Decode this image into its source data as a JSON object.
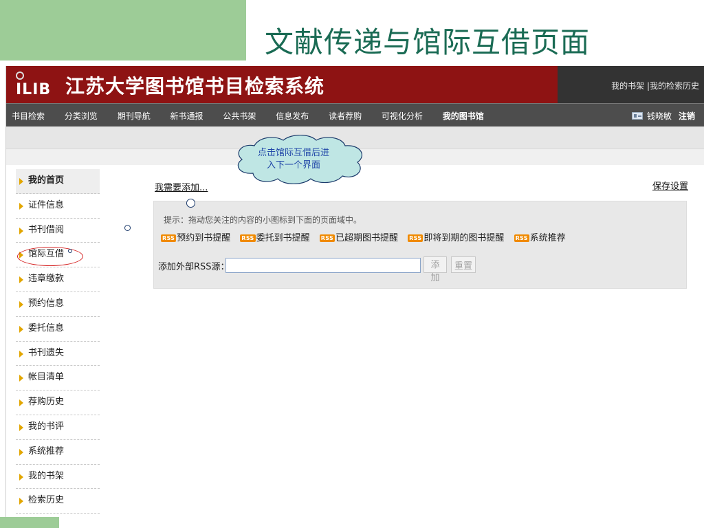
{
  "slide": {
    "title": "文献传递与馆际互借页面",
    "accent_green": "#9dcc97",
    "title_color": "#1a6b54"
  },
  "header": {
    "logo_text": "ILIB",
    "title": "江苏大学图书馆书目检索系统",
    "links": [
      "我的书架",
      "|我的检索历史"
    ],
    "bg_color": "#8e1313"
  },
  "nav": {
    "items": [
      "书目检索",
      "分类浏览",
      "期刊导航",
      "新书通报",
      "公共书架",
      "信息发布",
      "读者荐购",
      "可视化分析",
      "我的图书馆"
    ],
    "user_name": "钱晓敏",
    "logout_label": "注销"
  },
  "sidebar": {
    "items": [
      {
        "label": "我的首页"
      },
      {
        "label": "证件信息"
      },
      {
        "label": "书刊借阅"
      },
      {
        "label": "馆际互借"
      },
      {
        "label": "违章缴款"
      },
      {
        "label": "预约信息"
      },
      {
        "label": "委托信息"
      },
      {
        "label": "书刊遗失"
      },
      {
        "label": "帐目清单"
      },
      {
        "label": "荐购历史"
      },
      {
        "label": "我的书评"
      },
      {
        "label": "系统推荐"
      },
      {
        "label": "我的书架"
      },
      {
        "label": "检索历史"
      }
    ]
  },
  "main": {
    "add_link": "我需要添加...",
    "save_link": "保存设置",
    "hint": "提示：拖动您关注的内容的小图标到下面的页面域中。",
    "rss_badge": "RSS",
    "rss_items": [
      "预约到书提醒",
      "委托到书提醒",
      "已超期图书提醒",
      "即将到期的图书提醒",
      "系统推荐"
    ],
    "rss_label": "添加外部RSS源：",
    "rss_input_value": "",
    "add_button": "添加",
    "reset_button": "重置"
  },
  "annotation": {
    "bubble_text": "点击馆际互借后进入下一个界面",
    "bubble_fill": "#bfe6e4"
  }
}
